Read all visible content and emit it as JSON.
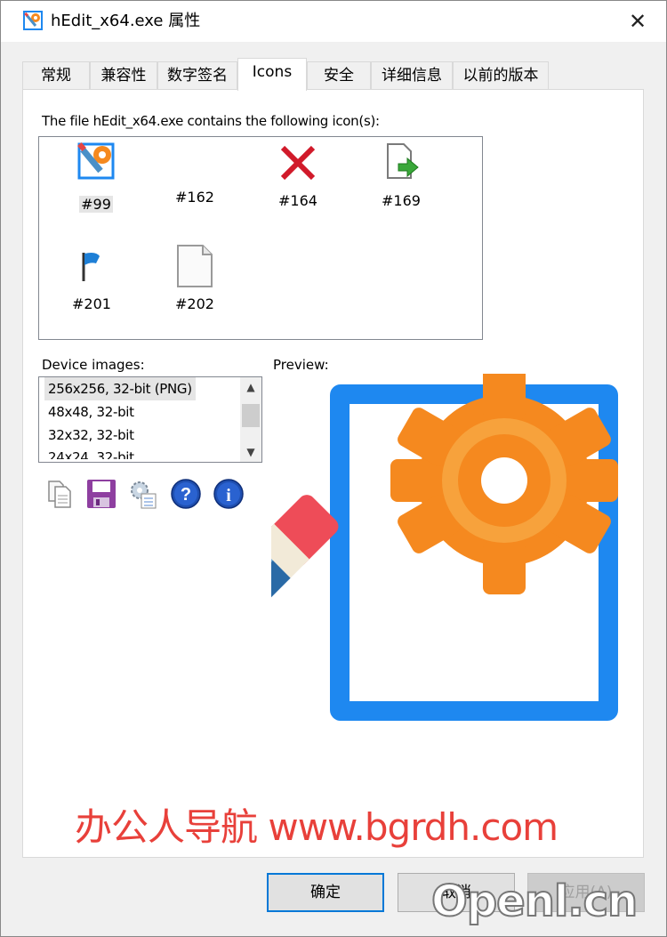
{
  "window": {
    "title": "hEdit_x64.exe 属性",
    "close_label": "✕"
  },
  "tabs": [
    {
      "label": "常规",
      "active": false
    },
    {
      "label": "兼容性",
      "active": false
    },
    {
      "label": "数字签名",
      "active": false
    },
    {
      "label": "Icons",
      "active": true
    },
    {
      "label": "安全",
      "active": false
    },
    {
      "label": "详细信息",
      "active": false
    },
    {
      "label": "以前的版本",
      "active": false
    }
  ],
  "icons_panel": {
    "description": "The file hEdit_x64.exe contains the following icon(s):",
    "icons": [
      {
        "id": "#99",
        "icon": "pencil-gear-icon",
        "selected": true
      },
      {
        "id": "#162",
        "icon": "blank-icon",
        "selected": false
      },
      {
        "id": "#164",
        "icon": "red-x-icon",
        "selected": false
      },
      {
        "id": "#169",
        "icon": "document-arrow-icon",
        "selected": false
      },
      {
        "id": "#201",
        "icon": "blue-flag-icon",
        "selected": false
      },
      {
        "id": "#202",
        "icon": "blank-document-icon",
        "selected": false
      }
    ],
    "device_images_label": "Device images:",
    "preview_label": "Preview:",
    "device_images": [
      {
        "label": "256x256, 32-bit (PNG)",
        "selected": true
      },
      {
        "label": "48x48, 32-bit",
        "selected": false
      },
      {
        "label": "32x32, 32-bit",
        "selected": false
      },
      {
        "label": "24x24, 32-bit",
        "selected": false
      }
    ],
    "toolbar": [
      "copy-icon",
      "save-icon",
      "settings-icon",
      "help-icon",
      "info-icon"
    ]
  },
  "watermark": "办公人导航 www.bgrdh.com",
  "watermark2": "Openl.cn",
  "buttons": {
    "ok": "确定",
    "cancel": "取消",
    "apply": "应用(A)"
  },
  "colors": {
    "accent": "#0078d7",
    "watermark": "#e8403a",
    "preview_frame": "#1e88f0",
    "gear": "#f5891f",
    "pencil_body": "#4a90c8"
  }
}
